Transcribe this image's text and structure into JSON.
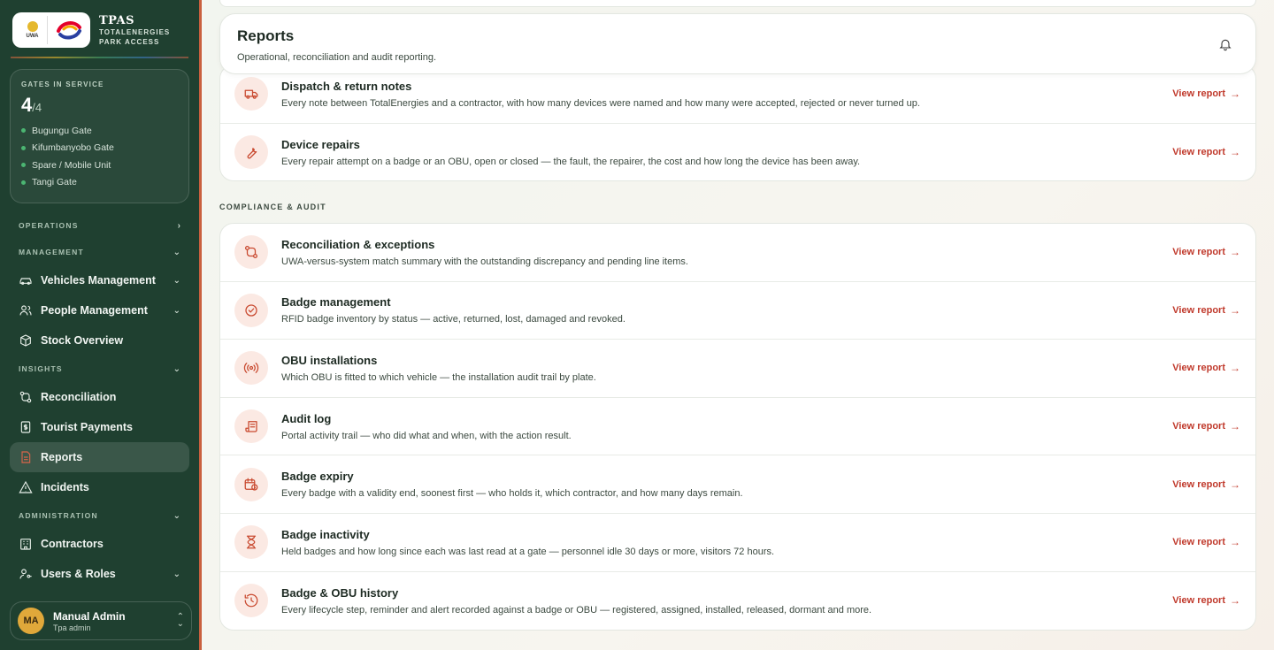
{
  "brand": {
    "title": "TPAS",
    "subtitle_line1": "TOTALENERGIES",
    "subtitle_line2": "PARK ACCESS",
    "uwa_logo_text": "UWA"
  },
  "gates": {
    "label": "GATES IN SERVICE",
    "count": "4",
    "total": "/4",
    "list": [
      "Bugungu Gate",
      "Kifumbanyobo Gate",
      "Spare / Mobile Unit",
      "Tangi Gate"
    ]
  },
  "nav": {
    "operations": "OPERATIONS",
    "management": "MANAGEMENT",
    "vehicles": "Vehicles Management",
    "people": "People Management",
    "stock": "Stock Overview",
    "insights": "INSIGHTS",
    "reconciliation": "Reconciliation",
    "tourist_payments": "Tourist Payments",
    "reports": "Reports",
    "incidents": "Incidents",
    "administration": "ADMINISTRATION",
    "contractors": "Contractors",
    "users_roles": "Users & Roles"
  },
  "user": {
    "initials": "MA",
    "name": "Manual Admin",
    "role": "Tpa admin"
  },
  "header": {
    "title": "Reports",
    "subtitle": "Operational, reconciliation and audit reporting."
  },
  "link_label": "View report",
  "link_arrow": "→",
  "operational_reports": [
    {
      "title": "Dispatch & return notes",
      "desc": "Every note between TotalEnergies and a contractor, with how many devices were named and how many were accepted, rejected or never turned up.",
      "icon": "truck-icon"
    },
    {
      "title": "Device repairs",
      "desc": "Every repair attempt on a badge or an OBU, open or closed — the fault, the repairer, the cost and how long the device has been away.",
      "icon": "wrench-icon"
    }
  ],
  "compliance_label": "COMPLIANCE & AUDIT",
  "compliance_reports": [
    {
      "title": "Reconciliation & exceptions",
      "desc": "UWA-versus-system match summary with the outstanding discrepancy and pending line items.",
      "icon": "reconcile-icon"
    },
    {
      "title": "Badge management",
      "desc": "RFID badge inventory by status — active, returned, lost, damaged and revoked.",
      "icon": "badge-check-icon"
    },
    {
      "title": "OBU installations",
      "desc": "Which OBU is fitted to which vehicle — the installation audit trail by plate.",
      "icon": "radio-icon"
    },
    {
      "title": "Audit log",
      "desc": "Portal activity trail — who did what and when, with the action result.",
      "icon": "scroll-icon"
    },
    {
      "title": "Badge expiry",
      "desc": "Every badge with a validity end, soonest first — who holds it, which contractor, and how many days remain.",
      "icon": "calendar-clock-icon"
    },
    {
      "title": "Badge inactivity",
      "desc": "Held badges and how long since each was last read at a gate — personnel idle 30 days or more, visitors 72 hours.",
      "icon": "hourglass-icon"
    },
    {
      "title": "Badge & OBU history",
      "desc": "Every lifecycle step, reminder and alert recorded against a badge or OBU — registered, assigned, installed, released, dormant and more.",
      "icon": "history-icon"
    }
  ]
}
